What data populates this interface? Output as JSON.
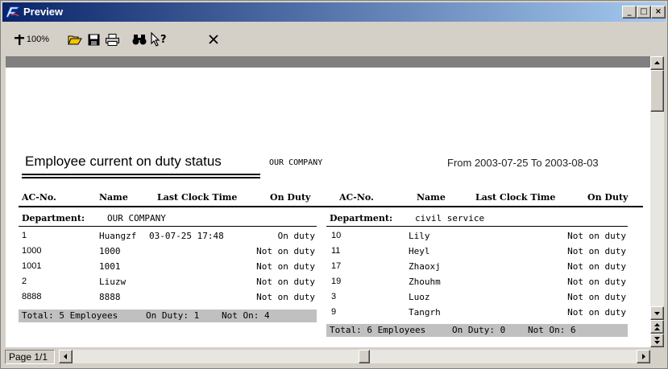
{
  "window": {
    "title": "Preview"
  },
  "toolbar": {
    "zoom_label": "100%"
  },
  "report": {
    "title": "Employee current on duty status",
    "company": "OUR COMPANY",
    "date_range": "From 2003-07-25 To 2003-08-03",
    "columns": [
      "AC-No.",
      "Name",
      "Last Clock Time",
      "On Duty"
    ],
    "department_label": "Department:",
    "left": {
      "department": "OUR COMPANY",
      "rows": [
        {
          "acno": "1",
          "name": "Huangzf",
          "time": "03-07-25 17:48",
          "status": "On duty"
        },
        {
          "acno": "1000",
          "name": "1000",
          "time": "",
          "status": "Not on duty"
        },
        {
          "acno": "1001",
          "name": "1001",
          "time": "",
          "status": "Not on duty"
        },
        {
          "acno": "2",
          "name": "Liuzw",
          "time": "",
          "status": "Not on duty"
        },
        {
          "acno": "8888",
          "name": "8888",
          "time": "",
          "status": "Not on duty"
        }
      ],
      "total": "Total: 5 Employees",
      "on_duty": "On Duty: 1",
      "not_on": "Not On: 4"
    },
    "right": {
      "department": "civil service",
      "rows": [
        {
          "acno": "10",
          "name": "Lily",
          "time": "",
          "status": "Not on duty"
        },
        {
          "acno": "11",
          "name": "Heyl",
          "time": "",
          "status": "Not on duty"
        },
        {
          "acno": "17",
          "name": "Zhaoxj",
          "time": "",
          "status": "Not on duty"
        },
        {
          "acno": "19",
          "name": "Zhouhm",
          "time": "",
          "status": "Not on duty"
        },
        {
          "acno": "3",
          "name": "Luoz",
          "time": "",
          "status": "Not on duty"
        },
        {
          "acno": "9",
          "name": "Tangrh",
          "time": "",
          "status": "Not on duty"
        }
      ],
      "total": "Total: 6 Employees",
      "on_duty": "On Duty: 0",
      "not_on": "Not On: 6"
    }
  },
  "status": {
    "page": "Page 1/1"
  }
}
